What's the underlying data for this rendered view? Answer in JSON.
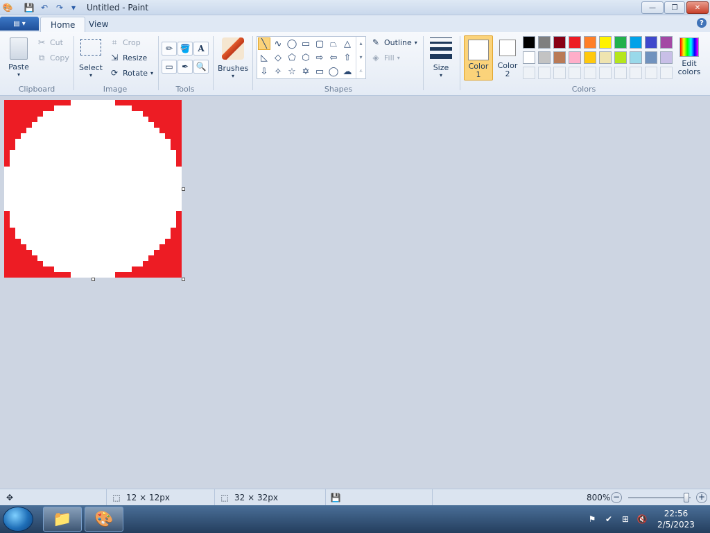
{
  "window": {
    "title": "Untitled - Paint"
  },
  "tabs": [
    {
      "label": "Home",
      "active": true
    },
    {
      "label": "View",
      "active": false
    }
  ],
  "clipboard": {
    "paste": "Paste",
    "cut": "Cut",
    "copy": "Copy",
    "group": "Clipboard"
  },
  "image": {
    "select": "Select",
    "crop": "Crop",
    "resize": "Resize",
    "rotate": "Rotate",
    "group": "Image"
  },
  "tools": {
    "group": "Tools",
    "text_glyph": "A"
  },
  "brushes": {
    "label": "Brushes"
  },
  "shapes": {
    "outline": "Outline",
    "fill": "Fill",
    "group": "Shapes"
  },
  "size": {
    "label": "Size"
  },
  "colors": {
    "color1_label": "Color\n1",
    "color1_line1": "Color",
    "color1_line2": "1",
    "color2_line1": "Color",
    "color2_line2": "2",
    "edit_line1": "Edit",
    "edit_line2": "colors",
    "group": "Colors",
    "palette_row1": [
      "#000000",
      "#7f7f7f",
      "#880015",
      "#ed1c24",
      "#ff7f27",
      "#fff200",
      "#22b14c",
      "#00a2e8",
      "#3f48cc",
      "#a349a4"
    ],
    "palette_row2": [
      "#ffffff",
      "#c3c3c3",
      "#b97a57",
      "#ffaec9",
      "#ffc90e",
      "#efe4b0",
      "#b5e61d",
      "#99d9ea",
      "#7092be",
      "#c8bfe7"
    ],
    "color1_value": "#ffffff",
    "color2_value": "#ffffff"
  },
  "canvas": {
    "fill_color": "#ed1c24",
    "shape_color": "#ffffff"
  },
  "status": {
    "selection": "12 × 12px",
    "canvas_size": "32 × 32px",
    "zoom": "800%",
    "zoom_fraction": 0.95
  },
  "taskbar": {
    "time": "22:56",
    "date": "2/5/2023"
  }
}
